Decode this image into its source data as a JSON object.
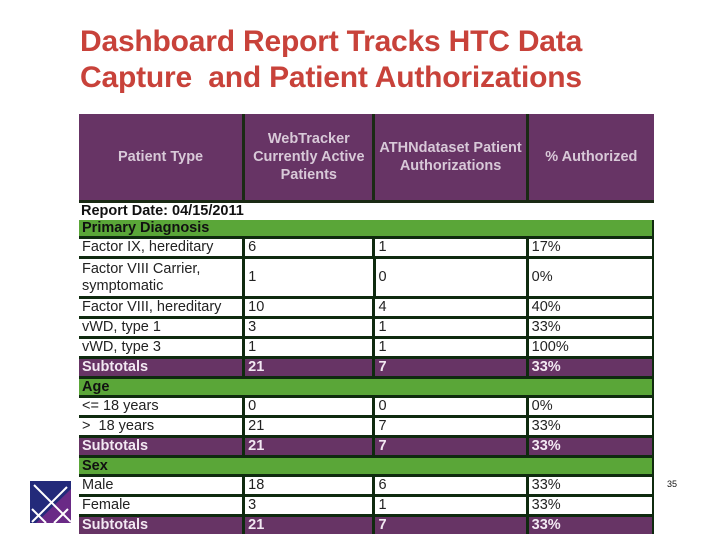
{
  "slide": {
    "title": "Dashboard Report Tracks HTC Data\nCapture  and Patient Authorizations",
    "page_number": "35",
    "logo_icon": "crossed-lines-logo-icon",
    "colors": {
      "title": "#c8423a",
      "header_bg": "#673465",
      "section_bg": "#5aa638",
      "border": "#0f2a0f"
    }
  },
  "table": {
    "headers": [
      "Patient Type",
      "WebTracker Currently Active Patients",
      "ATHNdataset Patient Authorizations",
      "% Authorized"
    ],
    "report_date": "Report Date: 04/15/2011",
    "sections": [
      {
        "name": "Primary Diagnosis",
        "rows": [
          [
            "Factor IX, hereditary",
            "6",
            "1",
            "17%"
          ],
          [
            "Factor VIII Carrier, symptomatic",
            "1",
            "0",
            "0%"
          ],
          [
            "Factor VIII, hereditary",
            "10",
            "4",
            "40%"
          ],
          [
            "vWD, type 1",
            "3",
            "1",
            "33%"
          ],
          [
            "vWD, type 3",
            "1",
            "1",
            "100%"
          ]
        ],
        "subtotal": [
          "Subtotals",
          "21",
          "7",
          "33%"
        ]
      },
      {
        "name": "Age",
        "rows": [
          [
            "<= 18 years",
            "0",
            "0",
            "0%"
          ],
          [
            ">  18 years",
            "21",
            "7",
            "33%"
          ]
        ],
        "subtotal": [
          "Subtotals",
          "21",
          "7",
          "33%"
        ]
      },
      {
        "name": "Sex",
        "rows": [
          [
            "Male",
            "18",
            "6",
            "33%"
          ],
          [
            "Female",
            "3",
            "1",
            "33%"
          ]
        ],
        "subtotal": [
          "Subtotals",
          "21",
          "7",
          "33%"
        ]
      }
    ]
  }
}
